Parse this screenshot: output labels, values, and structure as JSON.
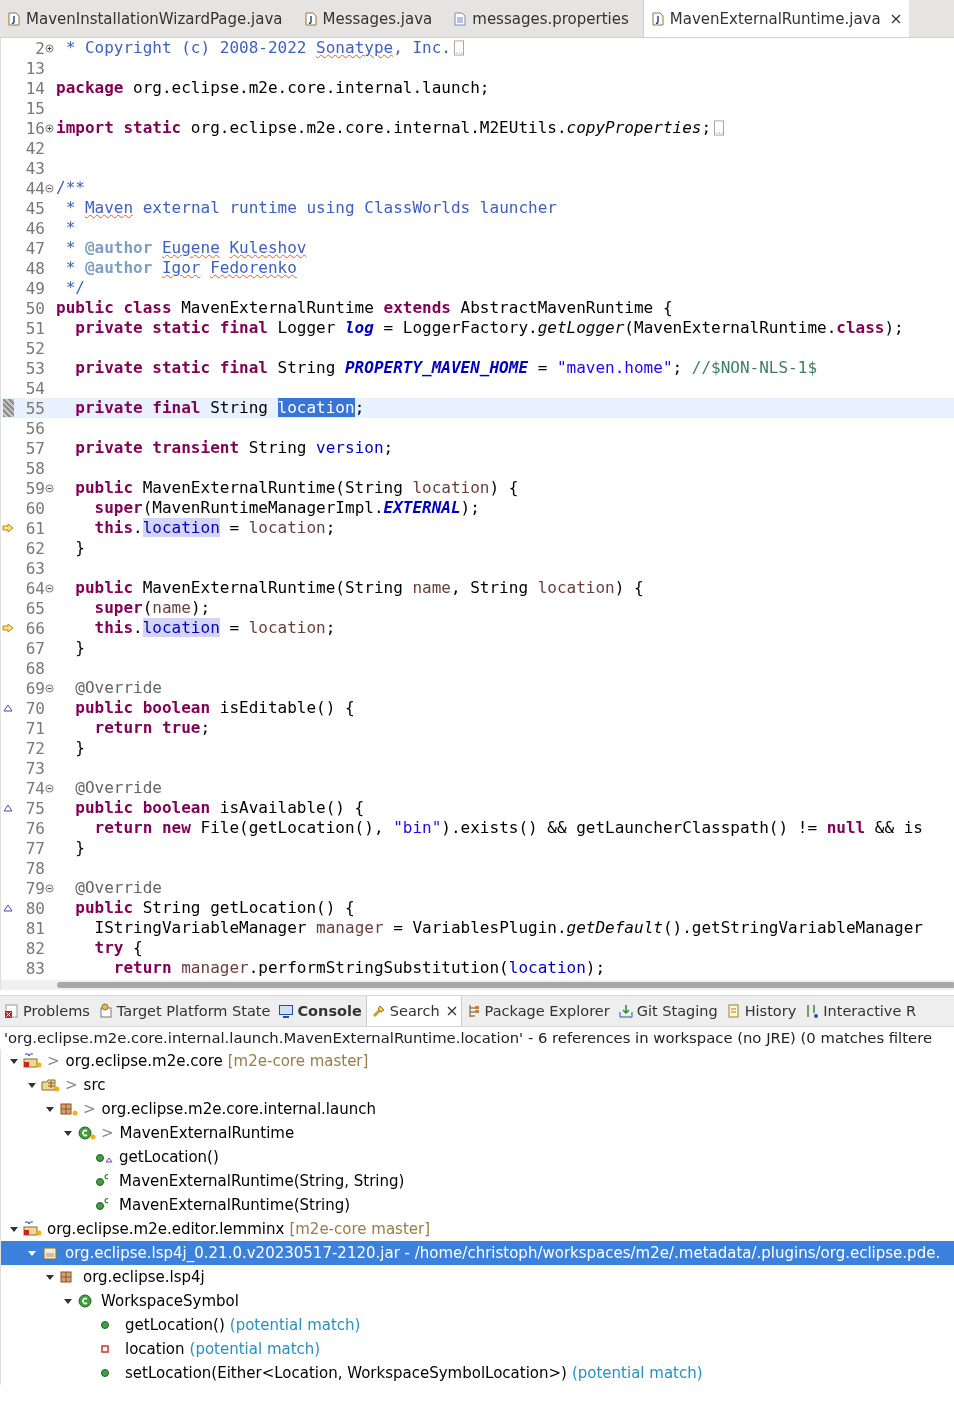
{
  "editor_tabs": [
    {
      "label": "MavenInstallationWizardPage.java",
      "kind": "java",
      "selected": false
    },
    {
      "label": "Messages.java",
      "kind": "java",
      "selected": false
    },
    {
      "label": "messages.properties",
      "kind": "text",
      "selected": false
    },
    {
      "label": "MavenExternalRuntime.java",
      "kind": "java",
      "selected": true
    }
  ],
  "editor": {
    "lines": [
      {
        "number": "2",
        "kind": "plain",
        "expanded": false,
        "selected": false,
        "tokens": [
          {
            "kind": "doc",
            "text": " * Copyright (c) 2008-2022 "
          },
          {
            "kind": "docspell",
            "text": "Sonatype"
          },
          {
            "kind": "doc",
            "text": ", Inc."
          }
        ]
      },
      {
        "number": "13",
        "kind": "plain",
        "selected": false
      },
      {
        "number": "14",
        "kind": "plain",
        "selected": false,
        "tokens": [
          {
            "kind": "kw",
            "text": "package"
          },
          {
            "kind": "text",
            "text": " org.eclipse.m2e.core.internal.launch;"
          }
        ]
      },
      {
        "number": "15",
        "kind": "plain",
        "selected": false
      },
      {
        "number": "16",
        "kind": "plain",
        "expanded": false,
        "selected": false,
        "tokens": [
          {
            "kind": "kw",
            "text": "import static"
          },
          {
            "kind": "text",
            "text": " org.eclipse.m2e.core.internal.M2EUtils."
          },
          {
            "kind": "italic",
            "text": "copyProperties"
          },
          {
            "kind": "text",
            "text": ";"
          }
        ]
      },
      {
        "number": "42",
        "kind": "plain",
        "selected": false
      },
      {
        "number": "43",
        "kind": "plain",
        "selected": false
      },
      {
        "number": "44",
        "kind": "plain",
        "expanded": true,
        "selected": false,
        "tokens": [
          {
            "kind": "doc",
            "text": "/**"
          }
        ]
      },
      {
        "number": "45",
        "kind": "plain",
        "selected": false,
        "tokens": [
          {
            "kind": "doc",
            "text": " * "
          },
          {
            "kind": "docspell",
            "text": "Maven"
          },
          {
            "kind": "doc",
            "text": " external runtime using ClassWorlds launcher"
          }
        ]
      },
      {
        "number": "46",
        "kind": "plain",
        "selected": false,
        "tokens": [
          {
            "kind": "doc",
            "text": " *"
          }
        ]
      },
      {
        "number": "47",
        "kind": "plain",
        "selected": false,
        "tokens": [
          {
            "kind": "doc",
            "text": " * "
          },
          {
            "kind": "doctag",
            "text": "@author "
          },
          {
            "kind": "docspell",
            "text": "Eugene Kuleshov"
          }
        ]
      },
      {
        "number": "48",
        "kind": "plain",
        "selected": false,
        "tokens": [
          {
            "kind": "doc",
            "text": " * "
          },
          {
            "kind": "doctag",
            "text": "@author "
          },
          {
            "kind": "docspell",
            "text": "Igor Fedorenko"
          }
        ]
      },
      {
        "number": "49",
        "kind": "plain",
        "selected": false,
        "tokens": [
          {
            "kind": "doc",
            "text": " */"
          }
        ]
      },
      {
        "number": "50",
        "kind": "plain",
        "selected": false,
        "tokens": [
          {
            "kind": "kw",
            "text": "public class"
          },
          {
            "kind": "text",
            "text": " MavenExternalRuntime "
          },
          {
            "kind": "kw",
            "text": "extends"
          },
          {
            "kind": "text",
            "text": " AbstractMavenRuntime {"
          }
        ]
      },
      {
        "number": "51",
        "kind": "plain",
        "selected": false,
        "tokens": [
          {
            "kind": "kw",
            "text": "  private static final"
          },
          {
            "kind": "text",
            "text": " Logger "
          },
          {
            "kind": "sfield",
            "text": "log"
          },
          {
            "kind": "text",
            "text": " = LoggerFactory."
          },
          {
            "kind": "italic",
            "text": "getLogger"
          },
          {
            "kind": "text",
            "text": "(MavenExternalRuntime."
          },
          {
            "kind": "kw",
            "text": "class"
          },
          {
            "kind": "text",
            "text": ");"
          }
        ]
      },
      {
        "number": "52",
        "kind": "plain",
        "selected": false
      },
      {
        "number": "53",
        "kind": "plain",
        "selected": false,
        "tokens": [
          {
            "kind": "kw",
            "text": "  private static final"
          },
          {
            "kind": "text",
            "text": " String "
          },
          {
            "kind": "sfield",
            "text": "PROPERTY_MAVEN_HOME"
          },
          {
            "kind": "text",
            "text": " = "
          },
          {
            "kind": "str",
            "text": "\"maven.home\""
          },
          {
            "kind": "text",
            "text": "; "
          },
          {
            "kind": "comment",
            "text": "//$NON-NLS-1$"
          }
        ]
      },
      {
        "number": "54",
        "kind": "plain",
        "selected": false
      },
      {
        "number": "55",
        "kind": "occurrence",
        "selected": true,
        "tokens": [
          {
            "kind": "kw",
            "text": "  private final"
          },
          {
            "kind": "text",
            "text": " String "
          },
          {
            "kind": "sel",
            "text": "location"
          },
          {
            "kind": "text",
            "text": ";"
          }
        ]
      },
      {
        "number": "56",
        "kind": "plain",
        "selected": false
      },
      {
        "number": "57",
        "kind": "plain",
        "selected": false,
        "tokens": [
          {
            "kind": "kw",
            "text": "  private transient"
          },
          {
            "kind": "text",
            "text": " String "
          },
          {
            "kind": "field",
            "text": "version"
          },
          {
            "kind": "text",
            "text": ";"
          }
        ]
      },
      {
        "number": "58",
        "kind": "plain",
        "selected": false
      },
      {
        "number": "59",
        "kind": "plain",
        "expanded": true,
        "selected": false,
        "tokens": [
          {
            "kind": "kw",
            "text": "  public"
          },
          {
            "kind": "text",
            "text": " MavenExternalRuntime(String "
          },
          {
            "kind": "local",
            "text": "location"
          },
          {
            "kind": "text",
            "text": ") {"
          }
        ]
      },
      {
        "number": "60",
        "kind": "plain",
        "selected": false,
        "tokens": [
          {
            "kind": "kw",
            "text": "    super"
          },
          {
            "kind": "text",
            "text": "(MavenRuntimeManagerImpl."
          },
          {
            "kind": "sfield",
            "text": "EXTERNAL"
          },
          {
            "kind": "text",
            "text": ");"
          }
        ]
      },
      {
        "number": "61",
        "kind": "write",
        "selected": false,
        "tokens": [
          {
            "kind": "kw",
            "text": "    this"
          },
          {
            "kind": "text",
            "text": "."
          },
          {
            "kind": "occ",
            "text": "location"
          },
          {
            "kind": "text",
            "text": " = "
          },
          {
            "kind": "local",
            "text": "location"
          },
          {
            "kind": "text",
            "text": ";"
          }
        ]
      },
      {
        "number": "62",
        "kind": "plain",
        "selected": false,
        "tokens": [
          {
            "kind": "text",
            "text": "  }"
          }
        ]
      },
      {
        "number": "63",
        "kind": "plain",
        "selected": false
      },
      {
        "number": "64",
        "kind": "plain",
        "expanded": true,
        "selected": false,
        "tokens": [
          {
            "kind": "kw",
            "text": "  public"
          },
          {
            "kind": "text",
            "text": " MavenExternalRuntime(String "
          },
          {
            "kind": "local",
            "text": "name"
          },
          {
            "kind": "text",
            "text": ", String "
          },
          {
            "kind": "local",
            "text": "location"
          },
          {
            "kind": "text",
            "text": ") {"
          }
        ]
      },
      {
        "number": "65",
        "kind": "plain",
        "selected": false,
        "tokens": [
          {
            "kind": "kw",
            "text": "    super"
          },
          {
            "kind": "text",
            "text": "("
          },
          {
            "kind": "local",
            "text": "name"
          },
          {
            "kind": "text",
            "text": ");"
          }
        ]
      },
      {
        "number": "66",
        "kind": "write",
        "selected": false,
        "tokens": [
          {
            "kind": "kw",
            "text": "    this"
          },
          {
            "kind": "text",
            "text": "."
          },
          {
            "kind": "occ",
            "text": "location"
          },
          {
            "kind": "text",
            "text": " = "
          },
          {
            "kind": "local",
            "text": "location"
          },
          {
            "kind": "text",
            "text": ";"
          }
        ]
      },
      {
        "number": "67",
        "kind": "plain",
        "selected": false,
        "tokens": [
          {
            "kind": "text",
            "text": "  }"
          }
        ]
      },
      {
        "number": "68",
        "kind": "plain",
        "selected": false
      },
      {
        "number": "69",
        "kind": "plain",
        "expanded": true,
        "selected": false,
        "tokens": [
          {
            "kind": "ann",
            "text": "  @Override"
          }
        ]
      },
      {
        "number": "70",
        "kind": "override",
        "selected": false,
        "tokens": [
          {
            "kind": "kw",
            "text": "  public boolean"
          },
          {
            "kind": "text",
            "text": " isEditable() {"
          }
        ]
      },
      {
        "number": "71",
        "kind": "plain",
        "selected": false,
        "tokens": [
          {
            "kind": "kw",
            "text": "    return true"
          },
          {
            "kind": "text",
            "text": ";"
          }
        ]
      },
      {
        "number": "72",
        "kind": "plain",
        "selected": false,
        "tokens": [
          {
            "kind": "text",
            "text": "  }"
          }
        ]
      },
      {
        "number": "73",
        "kind": "plain",
        "selected": false
      },
      {
        "number": "74",
        "kind": "plain",
        "expanded": true,
        "selected": false,
        "tokens": [
          {
            "kind": "ann",
            "text": "  @Override"
          }
        ]
      },
      {
        "number": "75",
        "kind": "override",
        "selected": false,
        "tokens": [
          {
            "kind": "kw",
            "text": "  public boolean"
          },
          {
            "kind": "text",
            "text": " isAvailable() {"
          }
        ]
      },
      {
        "number": "76",
        "kind": "plain",
        "selected": false,
        "tokens": [
          {
            "kind": "kw",
            "text": "    return new"
          },
          {
            "kind": "text",
            "text": " File(getLocation(), "
          },
          {
            "kind": "str",
            "text": "\"bin\""
          },
          {
            "kind": "text",
            "text": ").exists() && getLauncherClasspath() != "
          },
          {
            "kind": "kw",
            "text": "null"
          },
          {
            "kind": "text",
            "text": " && is"
          }
        ]
      },
      {
        "number": "77",
        "kind": "plain",
        "selected": false,
        "tokens": [
          {
            "kind": "text",
            "text": "  }"
          }
        ]
      },
      {
        "number": "78",
        "kind": "plain",
        "selected": false
      },
      {
        "number": "79",
        "kind": "plain",
        "expanded": true,
        "selected": false,
        "tokens": [
          {
            "kind": "ann",
            "text": "  @Override"
          }
        ]
      },
      {
        "number": "80",
        "kind": "override",
        "selected": false,
        "tokens": [
          {
            "kind": "kw",
            "text": "  public"
          },
          {
            "kind": "text",
            "text": " String getLocation() {"
          }
        ]
      },
      {
        "number": "81",
        "kind": "plain",
        "selected": false,
        "tokens": [
          {
            "kind": "text",
            "text": "    IStringVariableManager "
          },
          {
            "kind": "local",
            "text": "manager"
          },
          {
            "kind": "text",
            "text": " = VariablesPlugin."
          },
          {
            "kind": "italic",
            "text": "getDefault"
          },
          {
            "kind": "text",
            "text": "().getStringVariableManager"
          }
        ]
      },
      {
        "number": "82",
        "kind": "plain",
        "selected": false,
        "tokens": [
          {
            "kind": "kw",
            "text": "    try"
          },
          {
            "kind": "text",
            "text": " {"
          }
        ]
      },
      {
        "number": "83",
        "kind": "plain",
        "selected": false,
        "tokens": [
          {
            "kind": "kw",
            "text": "      return"
          },
          {
            "kind": "local",
            "text": " manager"
          },
          {
            "kind": "text",
            "text": ".performStringSubstitution("
          },
          {
            "kind": "field",
            "text": "location"
          },
          {
            "kind": "text",
            "text": ");"
          }
        ]
      }
    ]
  },
  "view_tabs": [
    {
      "label": "Problems",
      "kind": "problems",
      "selected": false,
      "bold": false
    },
    {
      "label": "Target Platform State",
      "kind": "target",
      "selected": false,
      "bold": false
    },
    {
      "label": "Console",
      "kind": "console",
      "selected": false,
      "bold": true
    },
    {
      "label": "Search",
      "kind": "search",
      "selected": true,
      "bold": false
    },
    {
      "label": "Package Explorer",
      "kind": "package-explorer",
      "selected": false,
      "bold": false
    },
    {
      "label": "Git Staging",
      "kind": "git-staging",
      "selected": false,
      "bold": false
    },
    {
      "label": "History",
      "kind": "history",
      "selected": false,
      "bold": false
    },
    {
      "label": "Interactive R",
      "kind": "rebase",
      "selected": false,
      "bold": false
    }
  ],
  "search": {
    "summary": "'org.eclipse.m2e.core.internal.launch.MavenExternalRuntime.location' - 6 references in workspace (no JRE) (0 matches filtere",
    "results": [
      {
        "kind": "project",
        "prefix": ">",
        "label": "org.eclipse.m2e.core",
        "decoration": {
          "kind": "git",
          "text": "[m2e-core master]"
        },
        "expanded": true,
        "selected": false,
        "children": [
          {
            "kind": "source-folder",
            "prefix": ">",
            "label": "src",
            "expanded": true,
            "selected": false,
            "children": [
              {
                "kind": "package",
                "prefix": ">",
                "label": "org.eclipse.m2e.core.internal.launch",
                "expanded": true,
                "selected": false,
                "children": [
                  {
                    "kind": "class",
                    "prefix": ">",
                    "label": "MavenExternalRuntime",
                    "expanded": true,
                    "selected": false,
                    "children": [
                      {
                        "kind": "method-override",
                        "label": "getLocation()",
                        "selected": false
                      },
                      {
                        "kind": "constructor",
                        "label": "MavenExternalRuntime(String, String)",
                        "selected": false
                      },
                      {
                        "kind": "constructor",
                        "label": "MavenExternalRuntime(String)",
                        "selected": false
                      }
                    ]
                  }
                ]
              }
            ]
          }
        ]
      },
      {
        "kind": "project",
        "label": "org.eclipse.m2e.editor.lemminx",
        "decoration": {
          "kind": "git",
          "text": "[m2e-core master]"
        },
        "expanded": true,
        "selected": false,
        "children": [
          {
            "kind": "jar",
            "label": "org.eclipse.lsp4j_0.21.0.v20230517-2120.jar - /home/christoph/workspaces/m2e/.metadata/.plugins/org.eclipse.pde.",
            "expanded": true,
            "selected": true,
            "children": [
              {
                "kind": "package",
                "label": "org.eclipse.lsp4j",
                "expanded": true,
                "selected": false,
                "children": [
                  {
                    "kind": "class",
                    "label": "WorkspaceSymbol",
                    "expanded": true,
                    "selected": false,
                    "children": [
                      {
                        "kind": "method",
                        "label": "getLocation()",
                        "decoration": {
                          "kind": "match",
                          "text": "(potential match)"
                        },
                        "selected": false
                      },
                      {
                        "kind": "field-private",
                        "label": "location",
                        "decoration": {
                          "kind": "match",
                          "text": "(potential match)"
                        },
                        "selected": false
                      },
                      {
                        "kind": "method",
                        "label": "setLocation(Either<Location, WorkspaceSymbolLocation>)",
                        "decoration": {
                          "kind": "match",
                          "text": "(potential match)"
                        },
                        "selected": false
                      }
                    ]
                  }
                ]
              }
            ]
          }
        ]
      }
    ]
  }
}
